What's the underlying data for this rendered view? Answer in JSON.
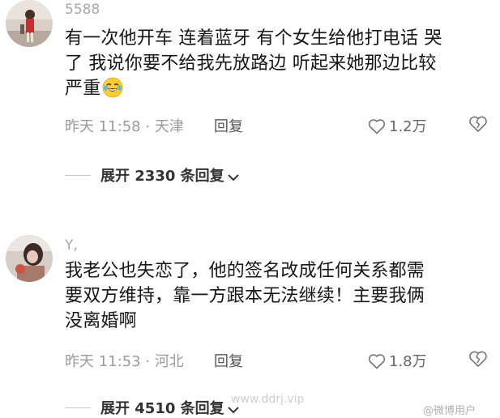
{
  "comments": [
    {
      "username": "5588",
      "lines": [
        "有一次他开车 连着蓝牙 有个女生给他打电话 哭",
        "了 我说你要不给我先放路边 听起来她那边比较",
        "严重"
      ],
      "emoji": "tears-of-joy-emoji",
      "time_location": "昨天 11:58 · 天津",
      "reply_label": "回复",
      "like_count": "1.2万",
      "expand_label": "展开 2330 条回复"
    },
    {
      "username": "Y,",
      "lines": [
        "我老公也失恋了，他的签名改成任何关系都需",
        "要双方维持，靠一方跟本无法继续！主要我俩",
        "没离婚啊"
      ],
      "time_location": "昨天 11:53 · 河北",
      "reply_label": "回复",
      "like_count": "1.8万",
      "expand_label": "展开 4510 条回复"
    }
  ],
  "watermark": "www.ddrj.vip",
  "corner_mark": "@微博用户",
  "colors": {
    "meta_gray": "#9a9a9a",
    "text_dark": "#161616"
  }
}
